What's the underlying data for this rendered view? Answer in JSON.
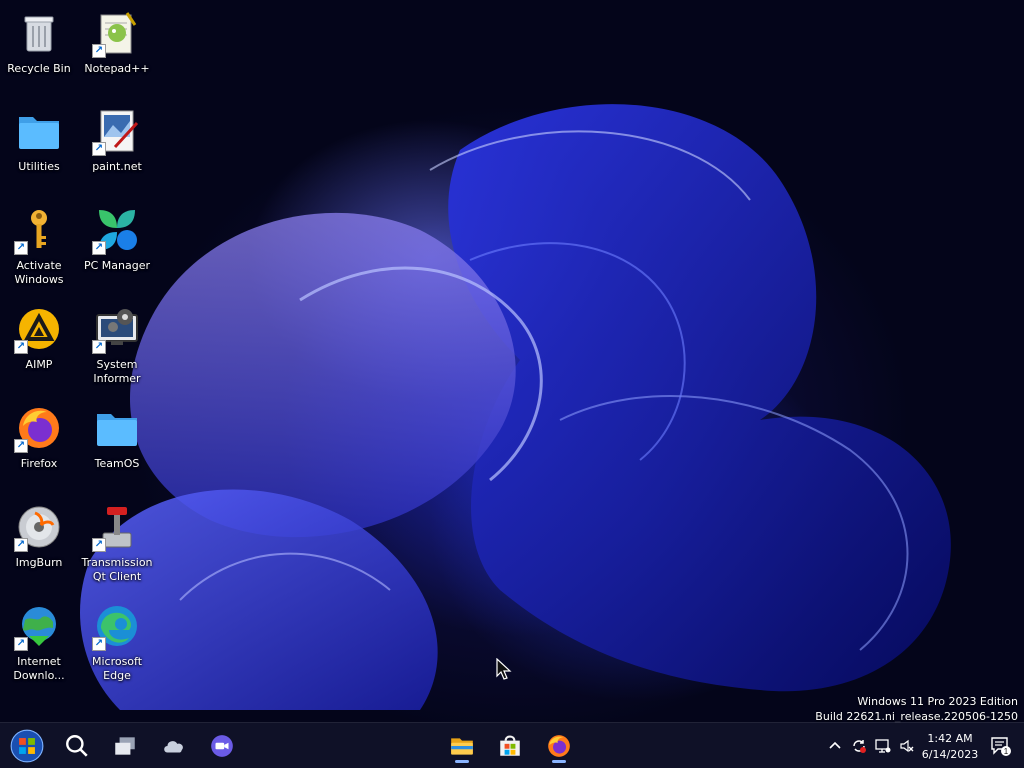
{
  "desktop_icons": [
    {
      "id": "recycle-bin",
      "label": "Recycle Bin",
      "icon": "recycle-bin-icon",
      "shortcut": false
    },
    {
      "id": "notepad-plus-plus",
      "label": "Notepad++",
      "icon": "notepad-plus-plus-icon",
      "shortcut": true
    },
    {
      "id": "utilities",
      "label": "Utilities",
      "icon": "folder-icon",
      "shortcut": false
    },
    {
      "id": "paint-net",
      "label": "paint.net",
      "icon": "paint-net-icon",
      "shortcut": true
    },
    {
      "id": "activate-windows",
      "label": "Activate\nWindows",
      "icon": "key-icon",
      "shortcut": true
    },
    {
      "id": "pc-manager",
      "label": "PC Manager",
      "icon": "pc-manager-icon",
      "shortcut": true
    },
    {
      "id": "aimp",
      "label": "AIMP",
      "icon": "aimp-icon",
      "shortcut": true
    },
    {
      "id": "system-informer",
      "label": "System\nInformer",
      "icon": "system-informer-icon",
      "shortcut": true
    },
    {
      "id": "firefox",
      "label": "Firefox",
      "icon": "firefox-icon",
      "shortcut": true
    },
    {
      "id": "teamos",
      "label": "TeamOS",
      "icon": "folder-icon",
      "shortcut": false
    },
    {
      "id": "imgburn",
      "label": "ImgBurn",
      "icon": "disc-icon",
      "shortcut": true
    },
    {
      "id": "transmission",
      "label": "Transmission\nQt Client",
      "icon": "transmission-icon",
      "shortcut": true
    },
    {
      "id": "internet-download-manager",
      "label": "Internet\nDownlo...",
      "icon": "idm-globe-icon",
      "shortcut": true
    },
    {
      "id": "microsoft-edge",
      "label": "Microsoft\nEdge",
      "icon": "edge-icon",
      "shortcut": true
    }
  ],
  "edition": {
    "line1": "Windows 11 Pro 2023 Edition",
    "line2": "Build 22621.ni_release.220506-1250"
  },
  "taskbar": {
    "left_buttons": [
      "start-orb-icon",
      "search-icon",
      "task-view-icon",
      "cloud-widgets-icon",
      "meet-camera-icon"
    ],
    "pinned_apps": [
      "file-explorer-icon",
      "microsoft-store-icon",
      "firefox-icon"
    ],
    "tray_icons": [
      "chevron-up-icon",
      "sync-icon",
      "network-icon",
      "volume-muted-icon"
    ],
    "clock": {
      "time": "1:42 AM",
      "date": "6/14/2023"
    },
    "notification_count": "1"
  },
  "colors": {
    "accent": "#3a4cff",
    "folder": "#4fb3ff",
    "taskbar": "#101228"
  }
}
